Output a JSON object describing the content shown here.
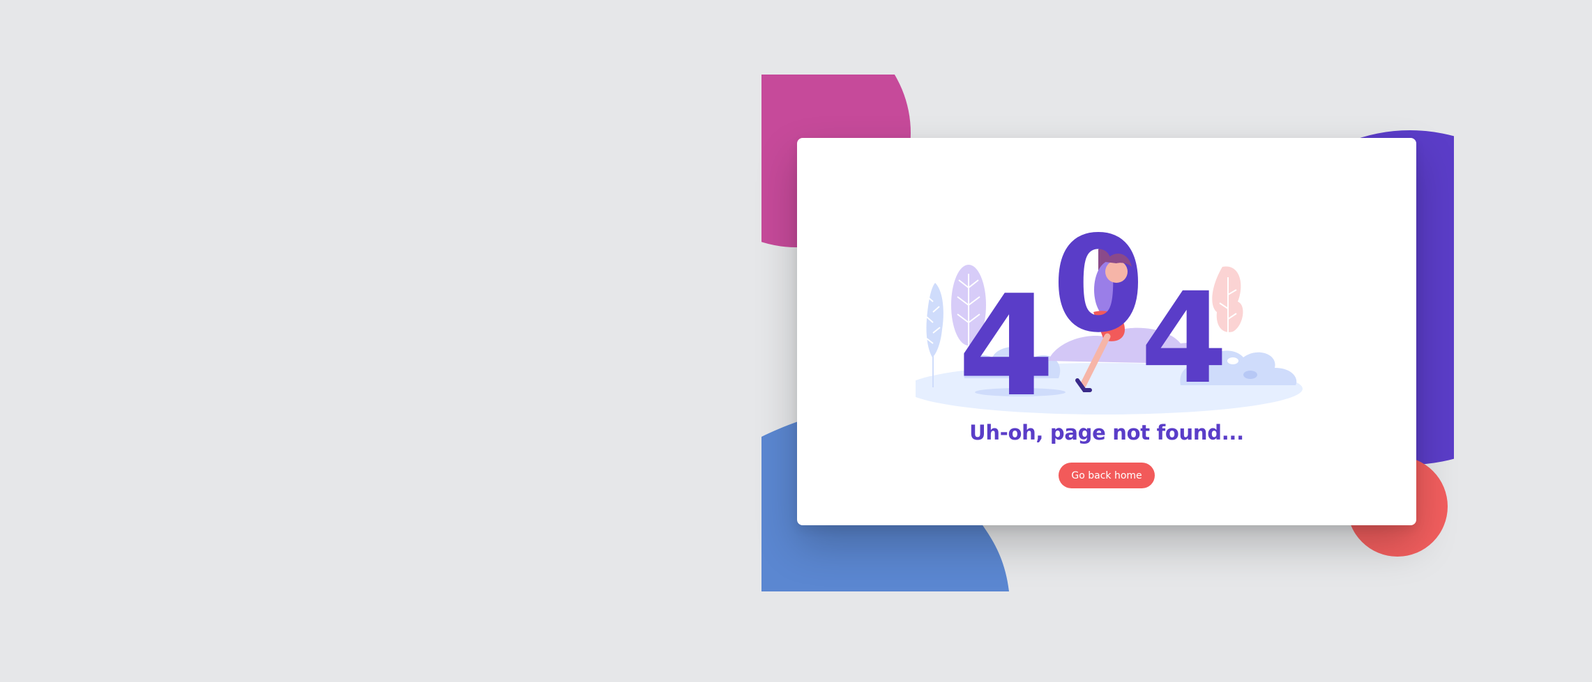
{
  "error_code": {
    "first_digit": "4",
    "middle_digit": "0",
    "last_digit": "4"
  },
  "message": {
    "title": "Uh-oh, page not found..."
  },
  "actions": {
    "home_label": "Go back home"
  },
  "colors": {
    "background": "#e6e7e9",
    "primary_purple": "#5a3dc8",
    "magenta": "#c64a9a",
    "blue": "#5b87d1",
    "coral": "#f25a5a",
    "card": "#ffffff"
  },
  "icons": {
    "illustration": "woman-sitting-on-404-illustration"
  }
}
